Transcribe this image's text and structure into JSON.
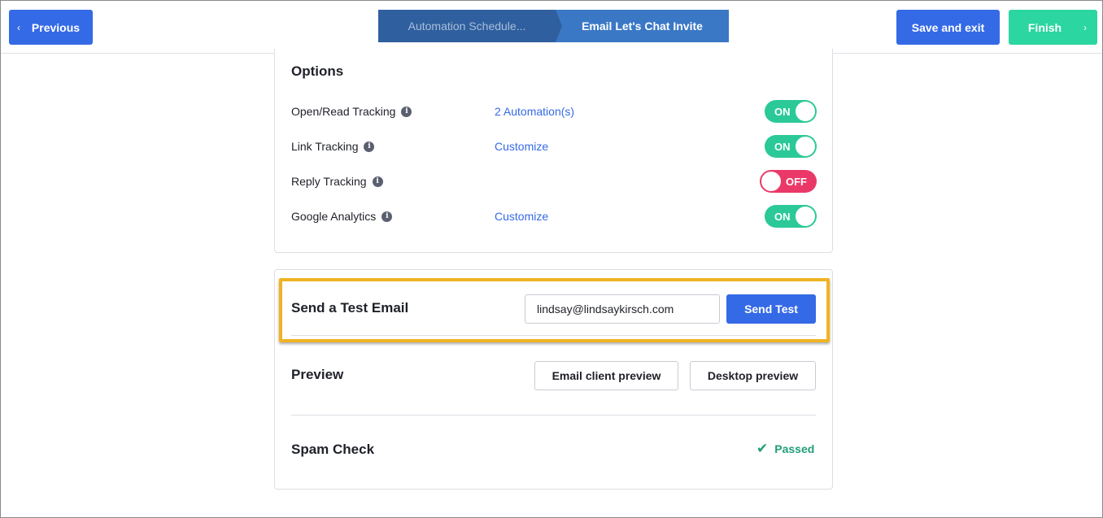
{
  "topbar": {
    "previous_label": "Previous",
    "save_label": "Save and exit",
    "finish_label": "Finish",
    "chevron_left": "‹",
    "chevron_right": "›"
  },
  "breadcrumbs": [
    {
      "label": "Automation Schedule..."
    },
    {
      "label": "Email Let's Chat Invite"
    }
  ],
  "options": {
    "title": "Options",
    "rows": [
      {
        "label": "Open/Read Tracking",
        "link": "2 Automation(s)",
        "toggle": "ON"
      },
      {
        "label": "Link Tracking",
        "link": "Customize",
        "toggle": "ON"
      },
      {
        "label": "Reply Tracking",
        "link": "",
        "toggle": "OFF"
      },
      {
        "label": "Google Analytics",
        "link": "Customize",
        "toggle": "ON"
      }
    ]
  },
  "test_email": {
    "title": "Send a Test Email",
    "email_value": "lindsay@lindsaykirsch.com",
    "send_label": "Send Test"
  },
  "preview": {
    "title": "Preview",
    "client_label": "Email client preview",
    "desktop_label": "Desktop preview"
  },
  "spam": {
    "title": "Spam Check",
    "status": "Passed"
  },
  "colors": {
    "primary": "#356ae6",
    "success": "#2bd6a0",
    "toggle_on": "#2bc997",
    "toggle_off": "#ea3968",
    "highlight": "#f0b323"
  }
}
